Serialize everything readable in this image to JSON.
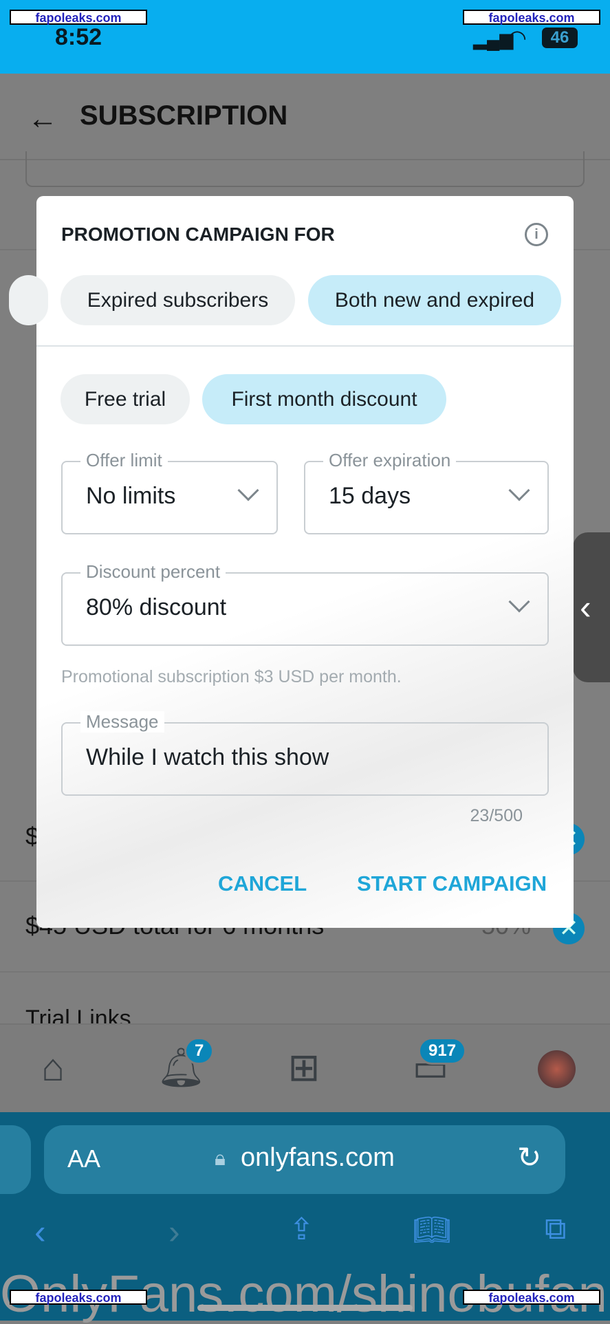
{
  "status": {
    "time": "8:52",
    "battery": "46"
  },
  "header": {
    "title": "SUBSCRIPTION",
    "back_icon": "arrow-left-icon"
  },
  "background": {
    "bundle_row": "$45 USD total for 6 months",
    "bundle_discount": "50%",
    "trial_links": "Trial Links",
    "partial_dollar": "$"
  },
  "modal": {
    "title": "PROMOTION CAMPAIGN FOR",
    "info_icon": "info-icon",
    "audience_chips": [
      {
        "label": "Expired subscribers",
        "selected": false
      },
      {
        "label": "Both new and expired",
        "selected": true
      }
    ],
    "type_chips": [
      {
        "label": "Free trial",
        "selected": false
      },
      {
        "label": "First month discount",
        "selected": true
      }
    ],
    "offer_limit": {
      "label": "Offer limit",
      "value": "No limits"
    },
    "offer_expiration": {
      "label": "Offer expiration",
      "value": "15 days"
    },
    "discount_percent": {
      "label": "Discount percent",
      "value": "80% discount"
    },
    "helper": "Promotional subscription $3 USD per month.",
    "message": {
      "label": "Message",
      "value": "While I watch this show"
    },
    "counter": "23/500",
    "cancel": "CANCEL",
    "start": "START CAMPAIGN"
  },
  "bottom_nav": {
    "notifications_badge": "7",
    "messages_badge": "917"
  },
  "browser": {
    "text_size": "AA",
    "url": "onlyfans.com"
  },
  "watermark": {
    "text": "OnlyFans.com/shinobufan",
    "site": "fapoleaks.com"
  },
  "colors": {
    "accent": "#1fa6d8",
    "status_bar": "#08aeef",
    "chip_selected": "#c6ecf9",
    "browser_bar": "#0b5f80"
  }
}
